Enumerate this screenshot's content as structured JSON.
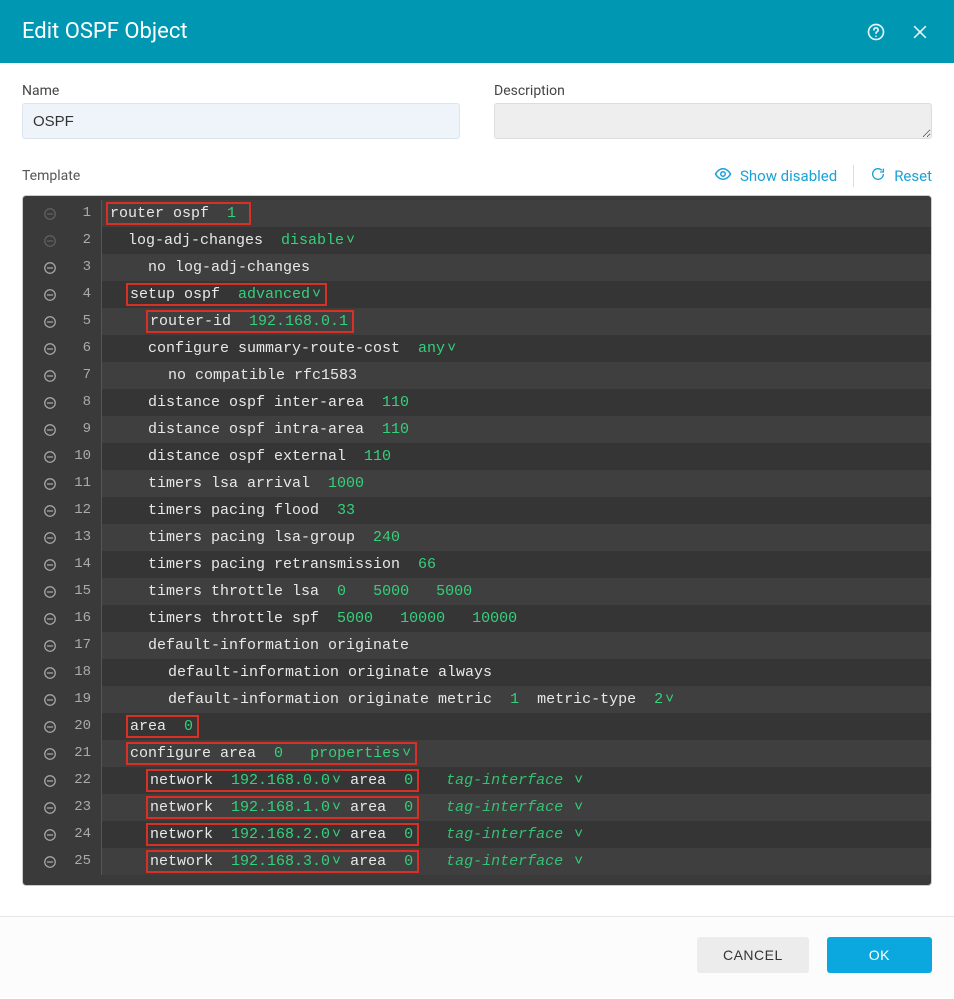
{
  "header": {
    "title": "Edit OSPF Object"
  },
  "fields": {
    "name_label": "Name",
    "name_value": "OSPF",
    "description_label": "Description",
    "description_value": ""
  },
  "toolbar": {
    "template_label": "Template",
    "show_disabled_label": "Show disabled",
    "reset_label": "Reset"
  },
  "footer": {
    "cancel_label": "CANCEL",
    "ok_label": "OK"
  },
  "lines": [
    {
      "n": 1,
      "indent": 0,
      "fold": "dim",
      "box": true,
      "tokens": [
        {
          "t": "router ospf ",
          "c": "kw"
        },
        {
          "t": " 1 ",
          "c": "val"
        }
      ]
    },
    {
      "n": 2,
      "indent": 1,
      "fold": "dim",
      "box": false,
      "tokens": [
        {
          "t": "log-adj-changes  ",
          "c": "kw"
        },
        {
          "t": "disable",
          "c": "valdd",
          "dd": true
        }
      ]
    },
    {
      "n": 3,
      "indent": 2,
      "fold": "open",
      "box": false,
      "tokens": [
        {
          "t": "no log-adj-changes",
          "c": "kw"
        }
      ]
    },
    {
      "n": 4,
      "indent": 1,
      "fold": "open",
      "box": true,
      "tokens": [
        {
          "t": "setup ospf  ",
          "c": "kw"
        },
        {
          "t": "advanced",
          "c": "valdd",
          "dd": true
        }
      ]
    },
    {
      "n": 5,
      "indent": 2,
      "fold": "open",
      "box": true,
      "tokens": [
        {
          "t": "router-id  ",
          "c": "kw"
        },
        {
          "t": "192.168.0.1",
          "c": "val"
        }
      ]
    },
    {
      "n": 6,
      "indent": 2,
      "fold": "open",
      "box": false,
      "tokens": [
        {
          "t": "configure summary-route-cost  ",
          "c": "kw"
        },
        {
          "t": "any",
          "c": "valdd",
          "dd": true
        }
      ]
    },
    {
      "n": 7,
      "indent": 3,
      "fold": "open",
      "box": false,
      "tokens": [
        {
          "t": "no compatible rfc1583",
          "c": "kw"
        }
      ]
    },
    {
      "n": 8,
      "indent": 2,
      "fold": "open",
      "box": false,
      "tokens": [
        {
          "t": "distance ospf inter-area  ",
          "c": "kw"
        },
        {
          "t": "110",
          "c": "val"
        }
      ]
    },
    {
      "n": 9,
      "indent": 2,
      "fold": "open",
      "box": false,
      "tokens": [
        {
          "t": "distance ospf intra-area  ",
          "c": "kw"
        },
        {
          "t": "110",
          "c": "val"
        }
      ]
    },
    {
      "n": 10,
      "indent": 2,
      "fold": "open",
      "box": false,
      "tokens": [
        {
          "t": "distance ospf external  ",
          "c": "kw"
        },
        {
          "t": "110",
          "c": "val"
        }
      ]
    },
    {
      "n": 11,
      "indent": 2,
      "fold": "open",
      "box": false,
      "tokens": [
        {
          "t": "timers lsa arrival  ",
          "c": "kw"
        },
        {
          "t": "1000",
          "c": "val"
        }
      ]
    },
    {
      "n": 12,
      "indent": 2,
      "fold": "open",
      "box": false,
      "tokens": [
        {
          "t": "timers pacing flood  ",
          "c": "kw"
        },
        {
          "t": "33",
          "c": "val"
        }
      ]
    },
    {
      "n": 13,
      "indent": 2,
      "fold": "open",
      "box": false,
      "tokens": [
        {
          "t": "timers pacing lsa-group  ",
          "c": "kw"
        },
        {
          "t": "240",
          "c": "val"
        }
      ]
    },
    {
      "n": 14,
      "indent": 2,
      "fold": "open",
      "box": false,
      "tokens": [
        {
          "t": "timers pacing retransmission  ",
          "c": "kw"
        },
        {
          "t": "66",
          "c": "val"
        }
      ]
    },
    {
      "n": 15,
      "indent": 2,
      "fold": "open",
      "box": false,
      "tokens": [
        {
          "t": "timers throttle lsa  ",
          "c": "kw"
        },
        {
          "t": "0",
          "c": "val"
        },
        {
          "t": "   ",
          "c": "kw"
        },
        {
          "t": "5000",
          "c": "val"
        },
        {
          "t": "   ",
          "c": "kw"
        },
        {
          "t": "5000",
          "c": "val"
        }
      ]
    },
    {
      "n": 16,
      "indent": 2,
      "fold": "open",
      "box": false,
      "tokens": [
        {
          "t": "timers throttle spf  ",
          "c": "kw"
        },
        {
          "t": "5000",
          "c": "val"
        },
        {
          "t": "   ",
          "c": "kw"
        },
        {
          "t": "10000",
          "c": "val"
        },
        {
          "t": "   ",
          "c": "kw"
        },
        {
          "t": "10000",
          "c": "val"
        }
      ]
    },
    {
      "n": 17,
      "indent": 2,
      "fold": "open",
      "box": false,
      "tokens": [
        {
          "t": "default-information originate",
          "c": "kw"
        }
      ]
    },
    {
      "n": 18,
      "indent": 3,
      "fold": "open",
      "box": false,
      "tokens": [
        {
          "t": "default-information originate always",
          "c": "kw"
        }
      ]
    },
    {
      "n": 19,
      "indent": 3,
      "fold": "open",
      "box": false,
      "tokens": [
        {
          "t": "default-information originate metric  ",
          "c": "kw"
        },
        {
          "t": "1",
          "c": "val"
        },
        {
          "t": "  metric-type  ",
          "c": "kw"
        },
        {
          "t": "2",
          "c": "valdd",
          "dd": true
        }
      ]
    },
    {
      "n": 20,
      "indent": 1,
      "fold": "open",
      "box": true,
      "tokens": [
        {
          "t": "area  ",
          "c": "kw"
        },
        {
          "t": "0",
          "c": "val"
        }
      ]
    },
    {
      "n": 21,
      "indent": 1,
      "fold": "open",
      "box": true,
      "tokens": [
        {
          "t": "configure area  ",
          "c": "kw"
        },
        {
          "t": "0",
          "c": "val"
        },
        {
          "t": "   ",
          "c": "kw"
        },
        {
          "t": "properties",
          "c": "valdd",
          "dd": true
        }
      ]
    },
    {
      "n": 22,
      "indent": 2,
      "fold": "open",
      "box": true,
      "trailing_tag": "tag-interface",
      "tokens": [
        {
          "t": "network  ",
          "c": "kw"
        },
        {
          "t": "192.168.0.0",
          "c": "valdd",
          "dd": true
        },
        {
          "t": " area  ",
          "c": "kw"
        },
        {
          "t": "0",
          "c": "val"
        }
      ]
    },
    {
      "n": 23,
      "indent": 2,
      "fold": "open",
      "box": true,
      "trailing_tag": "tag-interface",
      "tokens": [
        {
          "t": "network  ",
          "c": "kw"
        },
        {
          "t": "192.168.1.0",
          "c": "valdd",
          "dd": true
        },
        {
          "t": " area  ",
          "c": "kw"
        },
        {
          "t": "0",
          "c": "val"
        }
      ]
    },
    {
      "n": 24,
      "indent": 2,
      "fold": "open",
      "box": true,
      "trailing_tag": "tag-interface",
      "tokens": [
        {
          "t": "network  ",
          "c": "kw"
        },
        {
          "t": "192.168.2.0",
          "c": "valdd",
          "dd": true
        },
        {
          "t": " area  ",
          "c": "kw"
        },
        {
          "t": "0",
          "c": "val"
        }
      ]
    },
    {
      "n": 25,
      "indent": 2,
      "fold": "open",
      "box": true,
      "trailing_tag": "tag-interface",
      "tokens": [
        {
          "t": "network  ",
          "c": "kw"
        },
        {
          "t": "192.168.3.0",
          "c": "valdd",
          "dd": true
        },
        {
          "t": " area  ",
          "c": "kw"
        },
        {
          "t": "0",
          "c": "val"
        }
      ]
    }
  ]
}
